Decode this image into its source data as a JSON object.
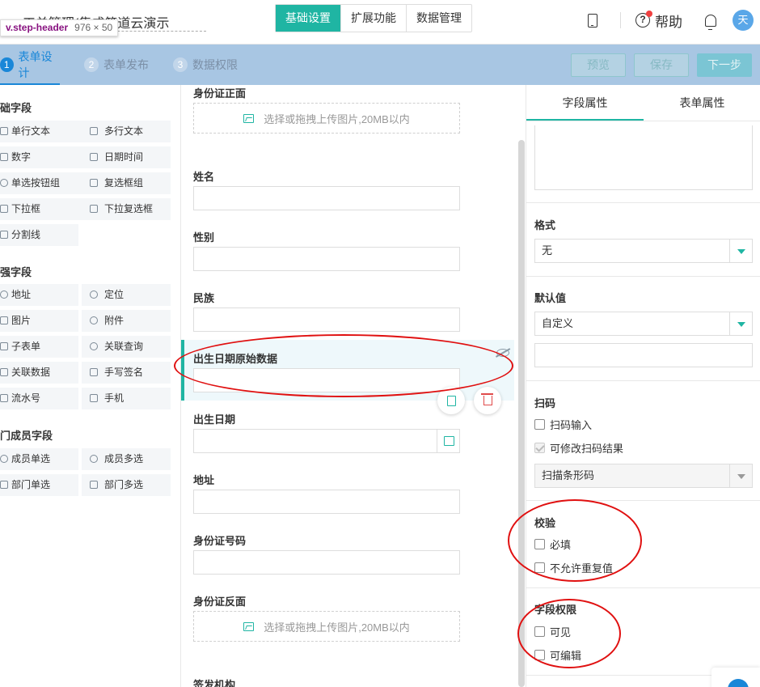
{
  "header": {
    "app_title": "工单管理(集成简道云演示",
    "dev_tag_name": "v.step-header",
    "dev_tag_dims": "976 × 50",
    "tabs": [
      {
        "label": "基础设置",
        "active": true
      },
      {
        "label": "扩展功能",
        "active": false
      },
      {
        "label": "数据管理",
        "active": false
      }
    ],
    "help_label": "帮助",
    "avatar_text": "天",
    "accent_color": "#1fb5a3"
  },
  "steps": {
    "items": [
      {
        "num": "1",
        "label": "表单设计",
        "active": true
      },
      {
        "num": "2",
        "label": "表单发布",
        "active": false
      },
      {
        "num": "3",
        "label": "数据权限",
        "active": false
      }
    ],
    "preview_label": "预览",
    "save_label": "保存",
    "next_label": "下一步"
  },
  "left": {
    "groups": [
      {
        "title": "础字段",
        "items": [
          "单行文本",
          "多行文本",
          "数字",
          "日期时间",
          "单选按钮组",
          "复选框组",
          "下拉框",
          "下拉复选框",
          "分割线"
        ]
      },
      {
        "title": "强字段",
        "items": [
          "地址",
          "定位",
          "图片",
          "附件",
          "子表单",
          "关联查询",
          "关联数据",
          "手写签名",
          "流水号",
          "手机"
        ]
      },
      {
        "title": "门成员字段",
        "items": [
          "成员单选",
          "成员多选",
          "部门单选",
          "部门多选"
        ]
      }
    ]
  },
  "form": {
    "id_front_label": "身份证正面",
    "upload_hint": "选择或拖拽上传图片,20MB以内",
    "name_label": "姓名",
    "gender_label": "性别",
    "ethnicity_label": "民族",
    "birth_raw_label": "出生日期原始数据",
    "birthdate_label": "出生日期",
    "address_label": "地址",
    "id_number_label": "身份证号码",
    "id_back_label": "身份证反面",
    "issuer_label": "签发机构"
  },
  "props": {
    "tab_field": "字段属性",
    "tab_form": "表单属性",
    "format_label": "格式",
    "format_value": "无",
    "default_label": "默认值",
    "default_value": "自定义",
    "scan_label": "扫码",
    "scan_input": "扫码输入",
    "scan_modify": "可修改扫码结果",
    "scan_type": "扫描条形码",
    "validate_label": "校验",
    "required": "必填",
    "no_duplicate": "不允许重复值",
    "permission_label": "字段权限",
    "visible": "可见",
    "editable": "可编辑"
  }
}
